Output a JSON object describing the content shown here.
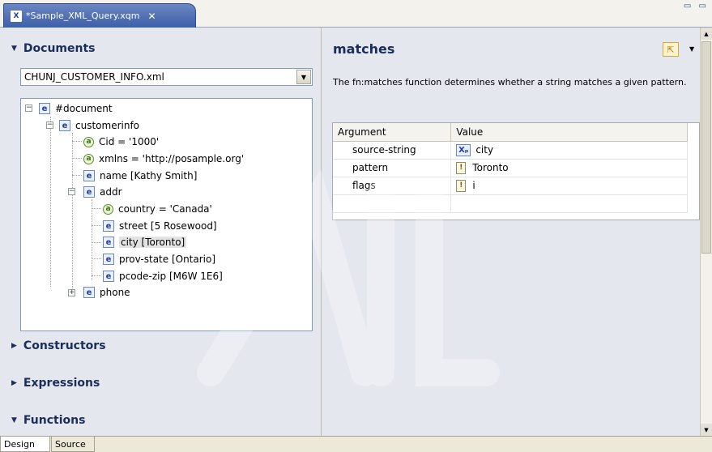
{
  "tab": {
    "title": "*Sample_XML_Query.xqm",
    "icon": "xquery-file-icon",
    "close_glyph": "✕"
  },
  "window_controls": "▭ ▭",
  "left": {
    "documents_label": "Documents",
    "document_select": "CHUNJ_CUSTOMER_INFO.xml",
    "tree": [
      {
        "text": "#document"
      },
      {
        "text": "customerinfo"
      },
      {
        "text": "Cid = '1000'"
      },
      {
        "text": "xmlns = 'http://posample.org'"
      },
      {
        "text": "name  [Kathy Smith]"
      },
      {
        "text": "addr"
      },
      {
        "text": "country = 'Canada'"
      },
      {
        "text": "street  [5 Rosewood]"
      },
      {
        "text": "city  [Toronto]"
      },
      {
        "text": "prov-state  [Ontario]"
      },
      {
        "text": "pcode-zip  [M6W 1E6]"
      },
      {
        "text": "phone"
      }
    ],
    "constructors_label": "Constructors",
    "expressions_label": "Expressions",
    "functions_label": "Functions"
  },
  "right": {
    "function_name": "matches",
    "description": "The fn:matches function determines whether a string matches a given pattern.",
    "table": {
      "headers": [
        "Argument",
        "Value"
      ],
      "rows": [
        {
          "argument": "source-string",
          "value": "city"
        },
        {
          "argument": "pattern",
          "value": "Toronto"
        },
        {
          "argument": "flags",
          "value": "i"
        }
      ]
    }
  },
  "bottom_tabs": {
    "design": "Design",
    "source": "Source"
  },
  "colors": {
    "tab_blue": "#3e5fa8",
    "section_heading": "#1a2e5a",
    "pane_bg": "#e4e7ee"
  }
}
